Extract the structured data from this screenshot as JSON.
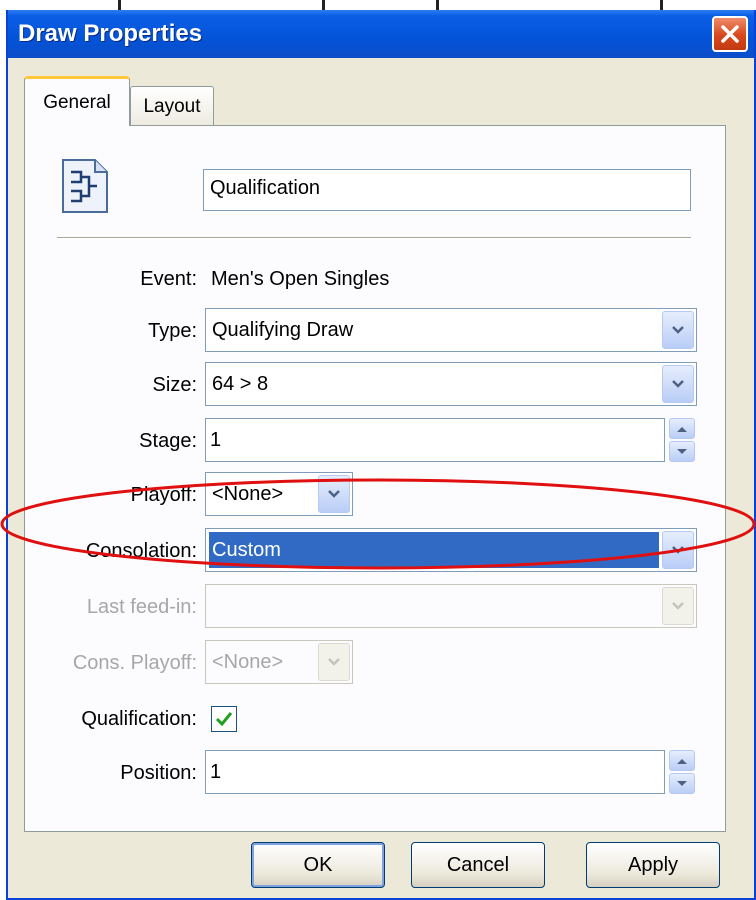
{
  "window": {
    "title": "Draw Properties"
  },
  "tabs": [
    {
      "label": "General",
      "active": true
    },
    {
      "label": "Layout",
      "active": false
    }
  ],
  "general": {
    "name_value": "Qualification",
    "event_label": "Event:",
    "event_value": "Men's Open Singles",
    "type_label": "Type:",
    "type_value": "Qualifying Draw",
    "size_label": "Size:",
    "size_value": "64 > 8",
    "stage_label": "Stage:",
    "stage_value": "1",
    "playoff_label": "Playoff:",
    "playoff_value": "<None>",
    "consolation_label": "Consolation:",
    "consolation_value": "Custom",
    "last_feedin_label": "Last feed-in:",
    "last_feedin_value": "",
    "cons_playoff_label": "Cons. Playoff:",
    "cons_playoff_value": "<None>",
    "qualification_label": "Qualification:",
    "qualification_checked": true,
    "position_label": "Position:",
    "position_value": "1"
  },
  "buttons": {
    "ok": "OK",
    "cancel": "Cancel",
    "apply": "Apply"
  },
  "colors": {
    "titlebar": "#0453d8",
    "selection": "#316ac5",
    "annotation": "#e01010"
  }
}
